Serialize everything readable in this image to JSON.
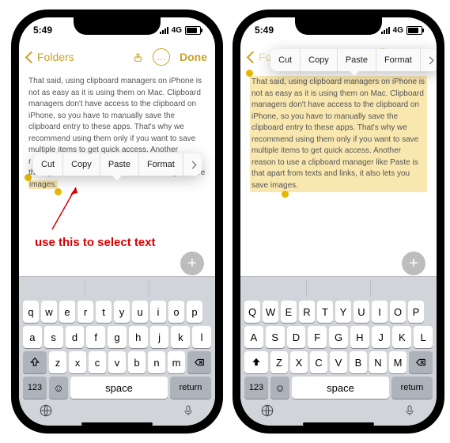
{
  "statusbar": {
    "time": "5:49",
    "net": "4G"
  },
  "navbar": {
    "back": "Folders",
    "done": "Done",
    "more": "…"
  },
  "note_text": "That said, using clipboard managers on iPhone is not as easy as it is using them on Mac. Clipboard managers don't have access to the clipboard on iPhone, so you have to manually save the clipboard entry to these apps. That's why we recommend using them only if you want to save multiple items to get quick access. Another reason to use a clipboard manager like Paste is that apart from texts and links, it also lets you save ",
  "note_obscured_line": "multiple items to get quick access. Another",
  "note_obscured_frag1": "r",
  "note_obscured_frag2": "e is",
  "note_tail_left": "that apa.. from texts and links, it also lets you save ",
  "note_sel_left": "images.",
  "note_sel_right_last": "images.",
  "context_menu": {
    "cut": "Cut",
    "copy": "Copy",
    "paste": "Paste",
    "format": "Format"
  },
  "annotation": "use this to select text",
  "keyboard": {
    "numbers": "123",
    "space": "space",
    "return": "return",
    "row1_lower": [
      "q",
      "w",
      "e",
      "r",
      "t",
      "y",
      "u",
      "i",
      "o",
      "p"
    ],
    "row2_lower": [
      "a",
      "s",
      "d",
      "f",
      "g",
      "h",
      "j",
      "k",
      "l"
    ],
    "row3_lower": [
      "z",
      "x",
      "c",
      "v",
      "b",
      "n",
      "m"
    ],
    "row1_upper": [
      "Q",
      "W",
      "E",
      "R",
      "T",
      "Y",
      "U",
      "I",
      "O",
      "P"
    ],
    "row2_upper": [
      "A",
      "S",
      "D",
      "F",
      "G",
      "H",
      "J",
      "K",
      "L"
    ],
    "row3_upper": [
      "Z",
      "X",
      "C",
      "V",
      "B",
      "N",
      "M"
    ]
  },
  "plus": "+"
}
